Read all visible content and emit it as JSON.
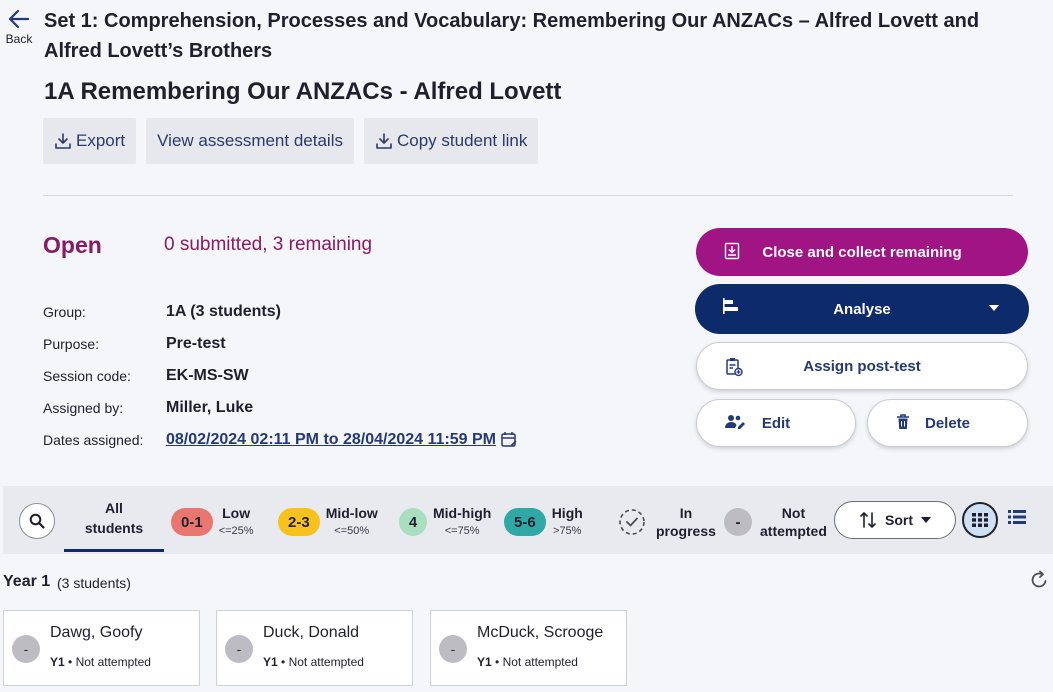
{
  "header": {
    "back_label": "Back",
    "set_title": "Set 1: Comprehension, Processes and Vocabulary: Remembering Our ANZACs – Alfred Lovett and Alfred Lovett’s Brothers",
    "assessment_title": "1A Remembering Our ANZACs - Alfred Lovett"
  },
  "toolbar": {
    "export_label": "Export",
    "view_details_label": "View assessment details",
    "copy_link_label": "Copy student link"
  },
  "status": {
    "state": "Open",
    "summary": "0 submitted, 3 remaining"
  },
  "details": [
    {
      "label": "Group:",
      "value": "1A (3 students)"
    },
    {
      "label": "Purpose:",
      "value": "Pre-test"
    },
    {
      "label": "Session code:",
      "value": "EK-MS-SW"
    },
    {
      "label": "Assigned by:",
      "value": "Miller, Luke"
    }
  ],
  "dates": {
    "label": "Dates assigned:",
    "value": "08/02/2024 02:11 PM to 28/04/2024 11:59 PM"
  },
  "actions": {
    "close_label": "Close and collect remaining",
    "analyse_label": "Analyse",
    "post_test_label": "Assign post-test",
    "edit_label": "Edit",
    "delete_label": "Delete"
  },
  "filters": {
    "all_line1": "All",
    "all_line2": "students",
    "bands": [
      {
        "pill": "0-1",
        "name": "Low",
        "sub": "<=25%",
        "color": "#ea7670"
      },
      {
        "pill": "2-3",
        "name": "Mid-low",
        "sub": "<=50%",
        "color": "#f7c21b"
      },
      {
        "pill": "4",
        "name": "Mid-high",
        "sub": "<=75%",
        "color": "#a9dfbf"
      },
      {
        "pill": "5-6",
        "name": "High",
        "sub": ">75%",
        "color": "#2fa8a6"
      }
    ],
    "in_progress_line1": "In",
    "in_progress_line2": "progress",
    "not_attempted_pill": "-",
    "not_attempted_line1": "Not",
    "not_attempted_line2": "attempted",
    "sort_label": "Sort"
  },
  "year_group": {
    "title": "Year 1",
    "count": "(3 students)"
  },
  "students": [
    {
      "avatar": "-",
      "name": "Dawg, Goofy",
      "year": "Y1",
      "status": "Not attempted"
    },
    {
      "avatar": "-",
      "name": "Duck, Donald",
      "year": "Y1",
      "status": "Not attempted"
    },
    {
      "avatar": "-",
      "name": "McDuck, Scrooge",
      "year": "Y1",
      "status": "Not attempted"
    }
  ]
}
